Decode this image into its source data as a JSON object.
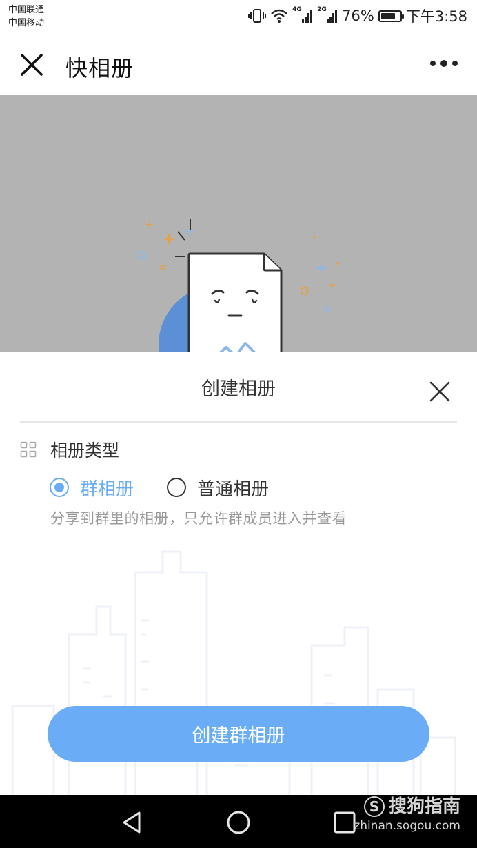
{
  "status_bar": {
    "carrier_1": "中国联通",
    "carrier_2": "中国移动",
    "signal_1_tag": "4G",
    "signal_2_tag": "2G",
    "battery": "76%",
    "battery_level": 0.76,
    "time": "下午3:58"
  },
  "nav": {
    "title": "快相册"
  },
  "sheet": {
    "title": "创建相册",
    "type_label": "相册类型",
    "options": [
      {
        "label": "群相册",
        "selected": true
      },
      {
        "label": "普通相册",
        "selected": false
      }
    ],
    "description": "分享到群里的相册，只允许群成员进入并查看",
    "create_button": "创建群相册"
  },
  "watermark": {
    "brand": "搜狗指南",
    "logo_letter": "S",
    "url": "zhinan.sogou.com"
  },
  "colors": {
    "accent": "#6aadf6",
    "backdrop": "#b3b3b3",
    "muted_text": "#999999"
  }
}
